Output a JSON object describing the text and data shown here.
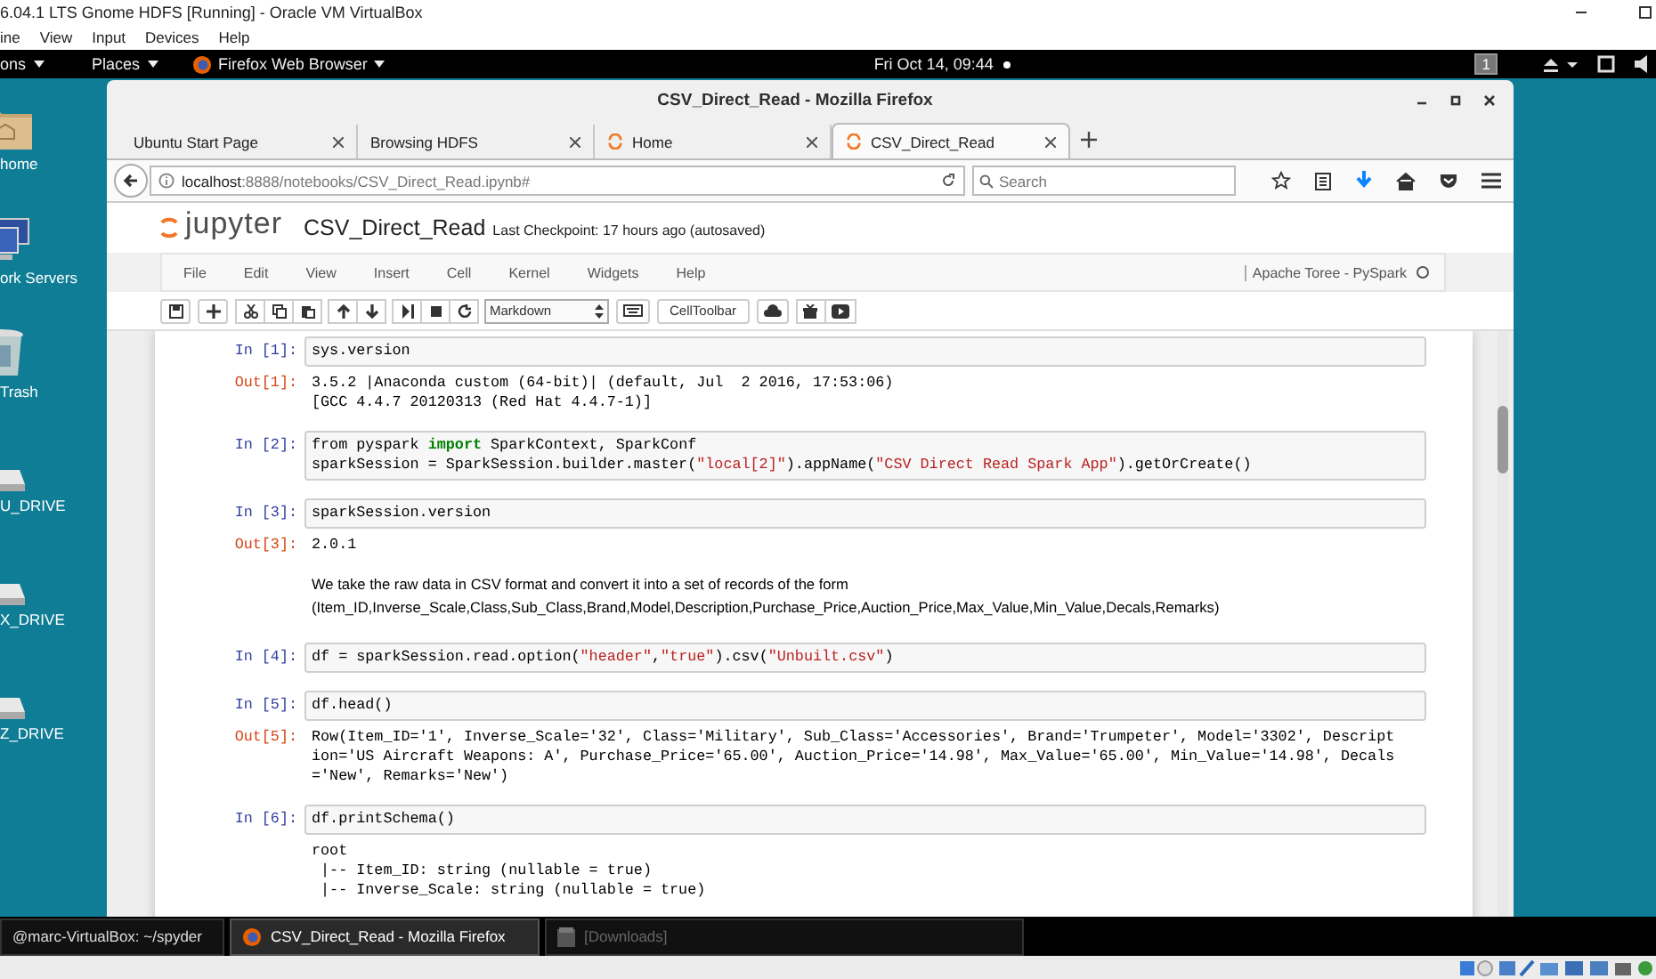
{
  "vm_window": {
    "title": "6.04.1 LTS Gnome HDFS [Running] - Oracle VM VirtualBox",
    "menu": [
      "ine",
      "View",
      "Input",
      "Devices",
      "Help"
    ]
  },
  "top_bar": {
    "menus": [
      "ons",
      "Places",
      "Firefox Web Browser"
    ],
    "clock": "Fri Oct 14, 09:44",
    "workspace": "1"
  },
  "desktop_icons": [
    {
      "kind": "folder",
      "label": "home"
    },
    {
      "kind": "network",
      "label": "ork Servers"
    },
    {
      "kind": "trash",
      "label": "Trash"
    },
    {
      "kind": "drive",
      "label": "U_DRIVE"
    },
    {
      "kind": "drive",
      "label": "X_DRIVE"
    },
    {
      "kind": "drive",
      "label": "Z_DRIVE"
    }
  ],
  "browser": {
    "title": "CSV_Direct_Read - Mozilla Firefox",
    "tabs": [
      {
        "label": "Ubuntu Start Page",
        "kind": "plain",
        "selected": false
      },
      {
        "label": "Browsing HDFS",
        "kind": "plain",
        "selected": false
      },
      {
        "label": "Home",
        "kind": "jupyter",
        "selected": false
      },
      {
        "label": "CSV_Direct_Read",
        "kind": "jupyter",
        "selected": true
      }
    ],
    "url_host": "localhost",
    "url_path": ":8888/notebooks/CSV_Direct_Read.ipynb#",
    "search": {
      "placeholder": "Search"
    }
  },
  "notebook": {
    "logo": "jupyter",
    "name": "CSV_Direct_Read",
    "checkpoint": "Last Checkpoint: 17 hours ago (autosaved)",
    "menu": [
      "File",
      "Edit",
      "View",
      "Insert",
      "Cell",
      "Kernel",
      "Widgets",
      "Help"
    ],
    "kernel": "Apache Toree - PySpark",
    "cell_type": "Markdown",
    "cell_toolbar": "CellToolbar",
    "cells": [
      {
        "kind": "code",
        "prompt": "In [1]:",
        "source": [
          [
            {
              "text": "sys.version",
              "kind": "plain"
            }
          ]
        ],
        "output": {
          "prompt": "Out[1]:",
          "lines": [
            "3.5.2 |Anaconda custom (64-bit)| (default, Jul  2 2016, 17:53:06)",
            "[GCC 4.4.7 20120313 (Red Hat 4.4.7-1)]"
          ]
        }
      },
      {
        "kind": "code",
        "prompt": "In [2]:",
        "source": [
          [
            {
              "text": "from pyspark ",
              "kind": "plain"
            },
            {
              "text": "import",
              "kind": "keyword"
            },
            {
              "text": " SparkContext, SparkConf",
              "kind": "plain"
            }
          ],
          [
            {
              "text": "sparkSession = SparkSession.builder.master(",
              "kind": "plain"
            },
            {
              "text": "\"local[2]\"",
              "kind": "string"
            },
            {
              "text": ").appName(",
              "kind": "plain"
            },
            {
              "text": "\"CSV Direct Read Spark App\"",
              "kind": "string"
            },
            {
              "text": ").getOrCreate()",
              "kind": "plain"
            }
          ]
        ]
      },
      {
        "kind": "code",
        "prompt": "In [3]:",
        "source": [
          [
            {
              "text": "sparkSession.version",
              "kind": "plain"
            }
          ]
        ],
        "output": {
          "prompt": "Out[3]:",
          "lines": [
            "2.0.1"
          ]
        }
      },
      {
        "kind": "markdown",
        "lines": [
          "We take the raw data in CSV format and convert it into a set of records of the form",
          "(Item_ID,Inverse_Scale,Class,Sub_Class,Brand,Model,Description,Purchase_Price,Auction_Price,Max_Value,Min_Value,Decals,Remarks)"
        ]
      },
      {
        "kind": "code",
        "prompt": "In [4]:",
        "source": [
          [
            {
              "text": "df = sparkSession.read.option(",
              "kind": "plain"
            },
            {
              "text": "\"header\"",
              "kind": "string"
            },
            {
              "text": ",",
              "kind": "plain"
            },
            {
              "text": "\"true\"",
              "kind": "string"
            },
            {
              "text": ").csv(",
              "kind": "plain"
            },
            {
              "text": "\"Unbuilt.csv\"",
              "kind": "string"
            },
            {
              "text": ")",
              "kind": "plain"
            }
          ]
        ]
      },
      {
        "kind": "code",
        "prompt": "In [5]:",
        "source": [
          [
            {
              "text": "df.head()",
              "kind": "plain"
            }
          ]
        ],
        "output": {
          "prompt": "Out[5]:",
          "lines": [
            "Row(Item_ID='1', Inverse_Scale='32', Class='Military', Sub_Class='Accessories', Brand='Trumpeter', Model='3302', Descript",
            "ion='US Aircraft Weapons: A', Purchase_Price='65.00', Auction_Price='14.98', Max_Value='65.00', Min_Value='14.98', Decals",
            "='New', Remarks='New')"
          ]
        }
      },
      {
        "kind": "code",
        "prompt": "In [6]:",
        "source": [
          [
            {
              "text": "df.printSchema()",
              "kind": "plain"
            }
          ]
        ],
        "output": {
          "lines": [
            "root",
            " |-- Item_ID: string (nullable = true)",
            " |-- Inverse_Scale: string (nullable = true)"
          ]
        }
      }
    ]
  },
  "taskbar": [
    {
      "label": "@marc-VirtualBox: ~/spyder",
      "kind": "terminal",
      "selected": false
    },
    {
      "label": "CSV_Direct_Read - Mozilla Firefox",
      "kind": "firefox",
      "selected": true
    },
    {
      "label": "[Downloads]",
      "kind": "files",
      "selected": false
    }
  ]
}
